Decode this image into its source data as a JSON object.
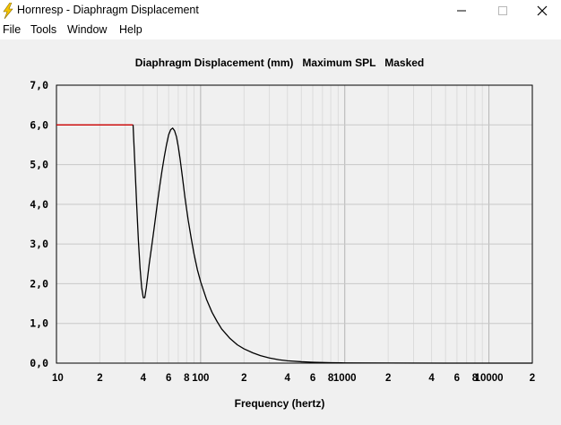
{
  "window": {
    "title": "Hornresp - Diaphragm Displacement",
    "icon": "lightning-bolt-icon",
    "controls": [
      "minimize-icon",
      "maximize-icon",
      "close-icon"
    ]
  },
  "menu": {
    "items": [
      "File",
      "Tools",
      "Window",
      "Help"
    ]
  },
  "chart_data": {
    "type": "line",
    "title": "Diaphragm Displacement (mm)   Maximum SPL   Masked",
    "xlabel": "Frequency (hertz)",
    "ylabel": "",
    "x_scale": "log",
    "xlim": [
      10,
      20000
    ],
    "ylim": [
      0,
      7
    ],
    "yticks": [
      0,
      1,
      2,
      3,
      4,
      5,
      6,
      7
    ],
    "ytick_labels": [
      "0,0",
      "1,0",
      "2,0",
      "3,0",
      "4,0",
      "5,0",
      "6,0",
      "7,0"
    ],
    "xticks": [
      10,
      20,
      40,
      60,
      80,
      100,
      200,
      400,
      600,
      800,
      1000,
      2000,
      4000,
      6000,
      8000,
      10000,
      20000
    ],
    "xtick_labels": [
      "10",
      "2",
      "4",
      "6",
      "8",
      "100",
      "2",
      "4",
      "6",
      "8",
      "1000",
      "2",
      "4",
      "6",
      "8",
      "10000",
      "2"
    ],
    "grid": true,
    "series": [
      {
        "color": "#cc0000",
        "x": [
          10,
          34
        ],
        "y": [
          6.0,
          6.0
        ]
      },
      {
        "color": "#000000",
        "x": [
          34,
          35,
          36,
          37,
          38,
          39,
          40,
          41,
          42,
          43,
          44,
          46,
          48,
          50,
          52,
          54,
          56,
          58,
          60,
          62,
          64,
          66,
          68,
          70,
          72,
          75,
          78,
          82,
          86,
          90,
          95,
          100,
          110,
          120,
          130,
          140,
          160,
          180,
          200,
          230,
          260,
          300,
          350,
          400,
          500,
          600,
          800,
          1000,
          2000,
          5000,
          10000,
          20000
        ],
        "y": [
          6.0,
          5.0,
          4.0,
          3.1,
          2.4,
          1.9,
          1.65,
          1.65,
          1.9,
          2.2,
          2.5,
          3.0,
          3.5,
          4.0,
          4.45,
          4.85,
          5.2,
          5.5,
          5.75,
          5.88,
          5.92,
          5.85,
          5.7,
          5.45,
          5.15,
          4.65,
          4.15,
          3.6,
          3.15,
          2.75,
          2.35,
          2.05,
          1.6,
          1.28,
          1.05,
          0.86,
          0.62,
          0.46,
          0.36,
          0.26,
          0.19,
          0.13,
          0.085,
          0.06,
          0.035,
          0.022,
          0.011,
          0.006,
          0.002,
          0.0005,
          0.0002,
          0.0001
        ]
      }
    ]
  }
}
